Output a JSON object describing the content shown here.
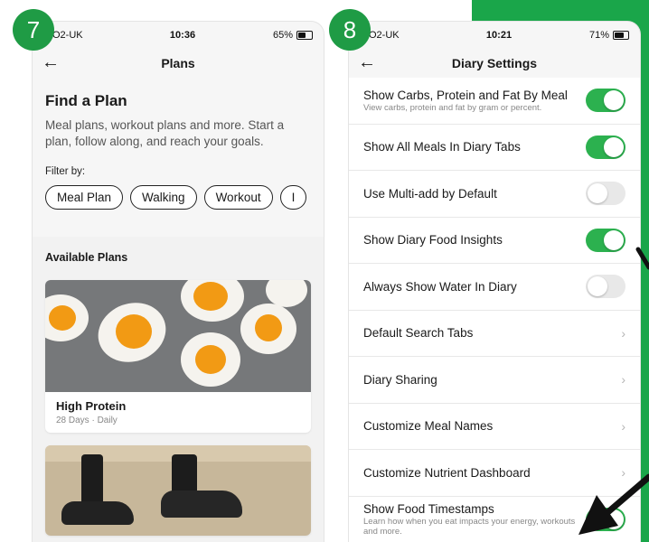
{
  "badges": {
    "left": "7",
    "right": "8"
  },
  "phone7": {
    "status": {
      "carrier": "O2-UK",
      "time": "10:36",
      "battery": "65%"
    },
    "nav_title": "Plans",
    "find": {
      "title": "Find a Plan",
      "description": "Meal plans, workout plans and more. Start a plan, follow along, and reach your goals.",
      "filter_label": "Filter by:",
      "chips": [
        "Meal Plan",
        "Walking",
        "Workout",
        "I"
      ]
    },
    "available_title": "Available Plans",
    "cards": [
      {
        "title": "High Protein",
        "subtitle": "28 Days · Daily"
      }
    ]
  },
  "phone8": {
    "status": {
      "carrier": "O2-UK",
      "time": "10:21",
      "battery": "71%"
    },
    "nav_title": "Diary Settings",
    "rows": [
      {
        "label": "Show Carbs, Protein and Fat By Meal",
        "hint": "View carbs, protein and fat by gram or percent.",
        "control": "on"
      },
      {
        "label": "Show All Meals In Diary Tabs",
        "hint": "",
        "control": "on"
      },
      {
        "label": "Use Multi-add by Default",
        "hint": "",
        "control": "off"
      },
      {
        "label": "Show Diary Food Insights",
        "hint": "",
        "control": "on"
      },
      {
        "label": "Always Show Water In Diary",
        "hint": "",
        "control": "off"
      },
      {
        "label": "Default Search Tabs",
        "hint": "",
        "control": "chevron"
      },
      {
        "label": "Diary Sharing",
        "hint": "",
        "control": "chevron"
      },
      {
        "label": "Customize Meal Names",
        "hint": "",
        "control": "chevron"
      },
      {
        "label": "Customize Nutrient Dashboard",
        "hint": "",
        "control": "chevron"
      },
      {
        "label": "Show Food Timestamps",
        "hint": "Learn how when you eat impacts your energy, workouts and more.",
        "control": "on"
      }
    ]
  },
  "colors": {
    "accent_green": "#2cb14f",
    "badge_green": "#1f9b45",
    "panel_green": "#1aa64a"
  }
}
